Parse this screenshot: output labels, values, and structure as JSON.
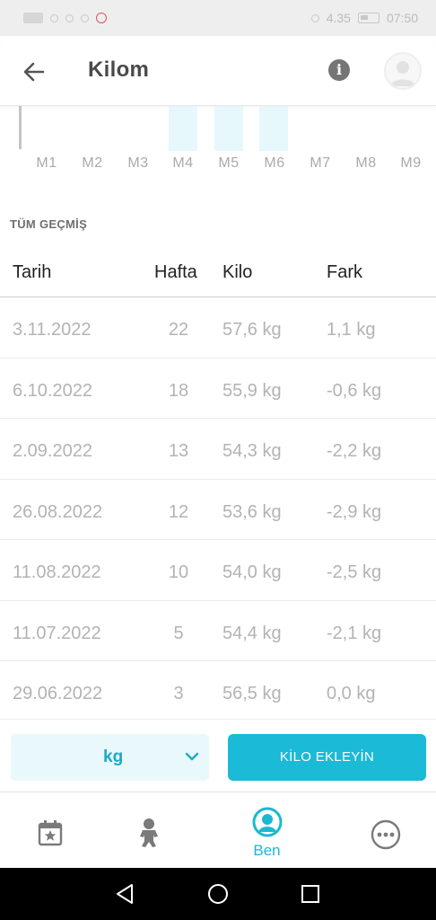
{
  "status_bar": {
    "network": "4.35",
    "time": "07:50"
  },
  "app_bar": {
    "title": "Kilom",
    "back_icon": "arrow-back-icon",
    "info_icon": "info-icon",
    "avatar_icon": "user-avatar-icon"
  },
  "chart": {
    "months": [
      "M1",
      "M2",
      "M3",
      "M4",
      "M5",
      "M6",
      "M7",
      "M8",
      "M9"
    ],
    "highlighted_months": [
      "M4",
      "M5",
      "M6"
    ]
  },
  "history": {
    "section_title": "TÜM GEÇMİŞ",
    "columns": {
      "date": "Tarih",
      "week": "Hafta",
      "kilo": "Kilo",
      "fark": "Fark"
    },
    "rows": [
      {
        "date": "3.11.2022",
        "week": "22",
        "kilo": "57,6 kg",
        "fark": "1,1 kg"
      },
      {
        "date": "6.10.2022",
        "week": "18",
        "kilo": "55,9 kg",
        "fark": "-0,6 kg"
      },
      {
        "date": "2.09.2022",
        "week": "13",
        "kilo": "54,3 kg",
        "fark": "-2,2 kg"
      },
      {
        "date": "26.08.2022",
        "week": "12",
        "kilo": "53,6 kg",
        "fark": "-2,9 kg"
      },
      {
        "date": "11.08.2022",
        "week": "10",
        "kilo": "54,0 kg",
        "fark": "-2,5 kg"
      },
      {
        "date": "11.07.2022",
        "week": "5",
        "kilo": "54,4 kg",
        "fark": "-2,1 kg"
      },
      {
        "date": "29.06.2022",
        "week": "3",
        "kilo": "56,5 kg",
        "fark": "0,0 kg"
      }
    ]
  },
  "actions": {
    "unit_value": "kg",
    "unit_chevron_icon": "chevron-down-icon",
    "add_button": "KİLO EKLEYİN"
  },
  "bottom_nav": {
    "items": [
      {
        "icon": "calendar-star-icon",
        "label": ""
      },
      {
        "icon": "baby-icon",
        "label": ""
      },
      {
        "icon": "mother-icon",
        "label": "Ben"
      },
      {
        "icon": "more-icon",
        "label": ""
      }
    ]
  },
  "colors": {
    "accent": "#1bbad6",
    "accent_light": "#e9f8fb",
    "muted_text": "#b3b3b3"
  }
}
